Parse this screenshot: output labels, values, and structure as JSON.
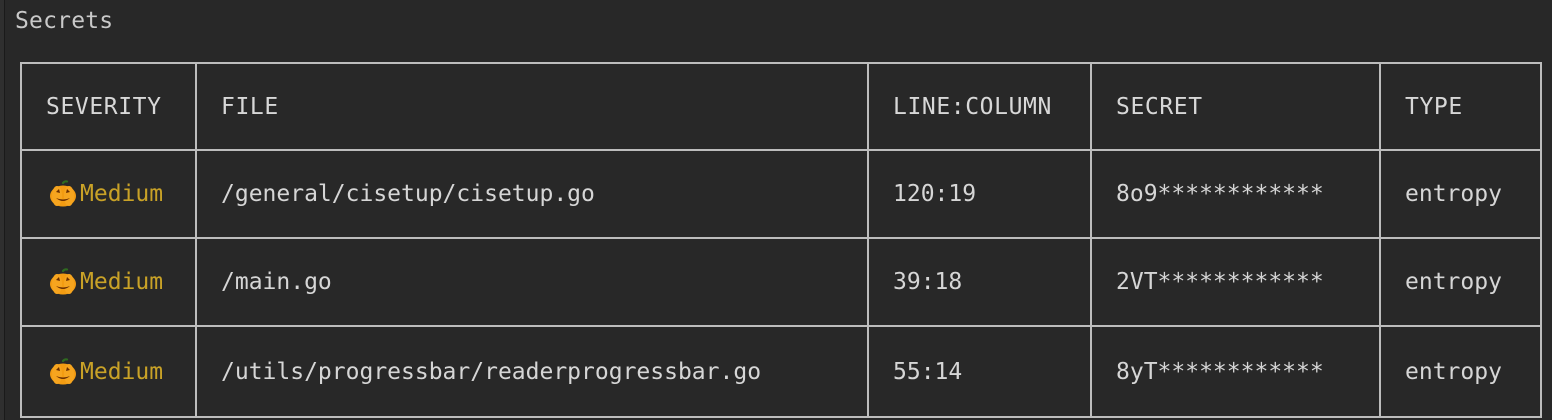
{
  "panel": {
    "title": "Secrets"
  },
  "table": {
    "headers": [
      "SEVERITY",
      "FILE",
      "LINE:COLUMN",
      "SECRET",
      "TYPE"
    ],
    "rows": [
      {
        "severity": "Medium",
        "severity_icon": "jack-o-lantern-icon",
        "file": "/general/cisetup/cisetup.go",
        "line_column": "120:19",
        "secret": "8o9************",
        "type": "entropy"
      },
      {
        "severity": "Medium",
        "severity_icon": "jack-o-lantern-icon",
        "file": "/main.go",
        "line_column": "39:18",
        "secret": "2VT************",
        "type": "entropy"
      },
      {
        "severity": "Medium",
        "severity_icon": "jack-o-lantern-icon",
        "file": "/utils/progressbar/readerprogressbar.go",
        "line_column": "55:14",
        "secret": "8yT************",
        "type": "entropy"
      }
    ]
  },
  "colors": {
    "background": "#282828",
    "text": "#d6d6d6",
    "border": "#bdbdbd",
    "severity_medium": "#c9a227",
    "pumpkin": "#f39c12"
  }
}
